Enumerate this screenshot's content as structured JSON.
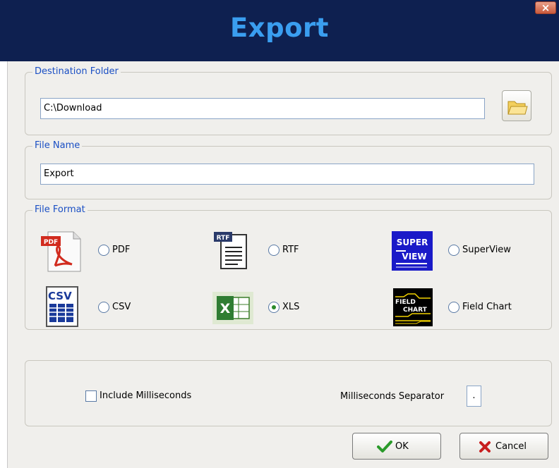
{
  "window": {
    "title": "Export",
    "close_glyph": "×"
  },
  "destination": {
    "legend": "Destination Folder",
    "path": "C:\\Download",
    "browse_icon": "folder-icon"
  },
  "file_name": {
    "legend": "File Name",
    "value": "Export"
  },
  "file_format": {
    "legend": "File Format",
    "options": [
      {
        "label": "PDF",
        "icon": "pdf-icon",
        "icon_text": "PDF",
        "checked": false
      },
      {
        "label": "RTF",
        "icon": "rtf-icon",
        "icon_text": "RTF",
        "checked": false
      },
      {
        "label": "SuperView",
        "icon": "superview-icon",
        "icon_text_1": "SUPER",
        "icon_text_2": "VIEW",
        "checked": false
      },
      {
        "label": "CSV",
        "icon": "csv-icon",
        "icon_text": "CSV",
        "checked": false
      },
      {
        "label": "XLS",
        "icon": "excel-icon",
        "icon_text": "X",
        "checked": true
      },
      {
        "label": "Field Chart",
        "icon": "fieldchart-icon",
        "icon_text_1": "FIELD",
        "icon_text_2": "CHART",
        "checked": false
      }
    ]
  },
  "options": {
    "include_ms_label": "Include Milliseconds",
    "include_ms_checked": false,
    "ms_separator_label": "Milliseconds Separator",
    "ms_separator_value": "."
  },
  "buttons": {
    "ok_label": "OK",
    "cancel_label": "Cancel"
  },
  "colors": {
    "title_bar": "#0e2050",
    "title_text": "#3a9ef0",
    "legend_text": "#1a4fc4",
    "ok_check": "#2a9a2a",
    "cancel_x": "#c81e1e"
  }
}
